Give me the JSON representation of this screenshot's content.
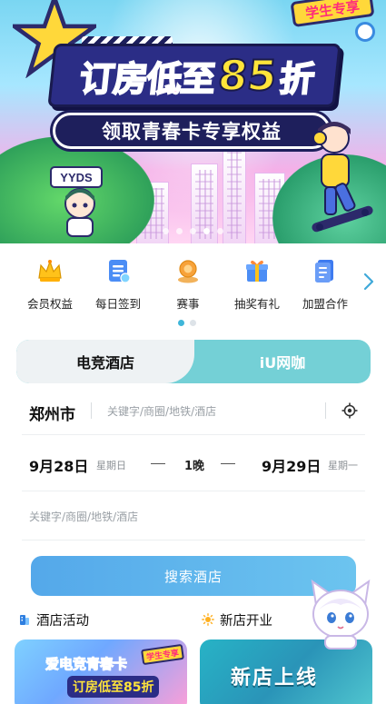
{
  "banner": {
    "student_badge": "学生专享",
    "headline_a": "订房低至",
    "headline_num": "85",
    "headline_b": "折",
    "subline": "领取青春卡专享权益",
    "mascot_tag": "YYDS",
    "slide_count": 5,
    "active_slide": 3
  },
  "quick_menu": {
    "items": [
      {
        "label": "会员权益",
        "icon": "crown-icon"
      },
      {
        "label": "每日签到",
        "icon": "checkin-icon"
      },
      {
        "label": "赛事",
        "icon": "trophy-icon"
      },
      {
        "label": "抽奖有礼",
        "icon": "gift-icon"
      },
      {
        "label": "加盟合作",
        "icon": "document-icon"
      }
    ],
    "page_count": 2,
    "active_page": 0
  },
  "tabs": [
    {
      "label": "电竞酒店",
      "selected": true
    },
    {
      "label": "iU网咖",
      "selected": false
    }
  ],
  "search": {
    "city": "郑州市",
    "keyword_placeholder": "关键字/商圈/地铁/酒店",
    "checkin_date": "9月28日",
    "checkin_weekday": "星期日",
    "nights": "1晚",
    "checkout_date": "9月29日",
    "checkout_weekday": "星期一",
    "keyword_placeholder_2": "关键字/商圈/地铁/酒店",
    "button": "搜索酒店"
  },
  "sections": {
    "hotel_activity": "酒店活动",
    "new_opening": "新店开业"
  },
  "cards": {
    "left_title": "爱电竞青春卡",
    "left_sub": "订房低至85折",
    "left_tag": "学生专享",
    "right_title": "新店上线"
  },
  "colors": {
    "accent_teal": "#74d0d6",
    "button_blue": "#5aaeea",
    "pager_active": "#3fb6d9"
  }
}
